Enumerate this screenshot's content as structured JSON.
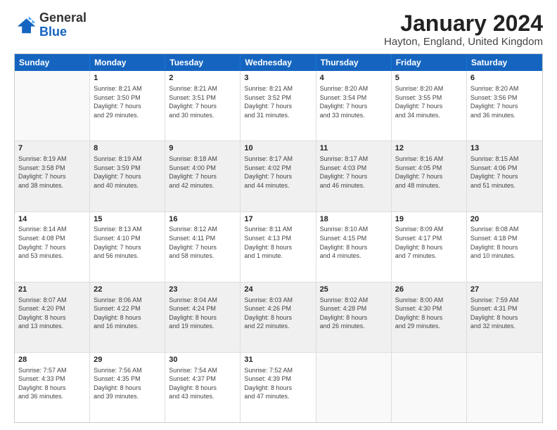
{
  "header": {
    "logo_general": "General",
    "logo_blue": "Blue",
    "month_title": "January 2024",
    "location": "Hayton, England, United Kingdom"
  },
  "days_of_week": [
    "Sunday",
    "Monday",
    "Tuesday",
    "Wednesday",
    "Thursday",
    "Friday",
    "Saturday"
  ],
  "weeks": [
    [
      {
        "day": "",
        "info": "",
        "empty": true
      },
      {
        "day": "1",
        "info": "Sunrise: 8:21 AM\nSunset: 3:50 PM\nDaylight: 7 hours\nand 29 minutes.",
        "shaded": false
      },
      {
        "day": "2",
        "info": "Sunrise: 8:21 AM\nSunset: 3:51 PM\nDaylight: 7 hours\nand 30 minutes.",
        "shaded": false
      },
      {
        "day": "3",
        "info": "Sunrise: 8:21 AM\nSunset: 3:52 PM\nDaylight: 7 hours\nand 31 minutes.",
        "shaded": false
      },
      {
        "day": "4",
        "info": "Sunrise: 8:20 AM\nSunset: 3:54 PM\nDaylight: 7 hours\nand 33 minutes.",
        "shaded": false
      },
      {
        "day": "5",
        "info": "Sunrise: 8:20 AM\nSunset: 3:55 PM\nDaylight: 7 hours\nand 34 minutes.",
        "shaded": false
      },
      {
        "day": "6",
        "info": "Sunrise: 8:20 AM\nSunset: 3:56 PM\nDaylight: 7 hours\nand 36 minutes.",
        "shaded": false
      }
    ],
    [
      {
        "day": "7",
        "info": "Sunrise: 8:19 AM\nSunset: 3:58 PM\nDaylight: 7 hours\nand 38 minutes.",
        "shaded": true
      },
      {
        "day": "8",
        "info": "Sunrise: 8:19 AM\nSunset: 3:59 PM\nDaylight: 7 hours\nand 40 minutes.",
        "shaded": true
      },
      {
        "day": "9",
        "info": "Sunrise: 8:18 AM\nSunset: 4:00 PM\nDaylight: 7 hours\nand 42 minutes.",
        "shaded": true
      },
      {
        "day": "10",
        "info": "Sunrise: 8:17 AM\nSunset: 4:02 PM\nDaylight: 7 hours\nand 44 minutes.",
        "shaded": true
      },
      {
        "day": "11",
        "info": "Sunrise: 8:17 AM\nSunset: 4:03 PM\nDaylight: 7 hours\nand 46 minutes.",
        "shaded": true
      },
      {
        "day": "12",
        "info": "Sunrise: 8:16 AM\nSunset: 4:05 PM\nDaylight: 7 hours\nand 48 minutes.",
        "shaded": true
      },
      {
        "day": "13",
        "info": "Sunrise: 8:15 AM\nSunset: 4:06 PM\nDaylight: 7 hours\nand 51 minutes.",
        "shaded": true
      }
    ],
    [
      {
        "day": "14",
        "info": "Sunrise: 8:14 AM\nSunset: 4:08 PM\nDaylight: 7 hours\nand 53 minutes.",
        "shaded": false
      },
      {
        "day": "15",
        "info": "Sunrise: 8:13 AM\nSunset: 4:10 PM\nDaylight: 7 hours\nand 56 minutes.",
        "shaded": false
      },
      {
        "day": "16",
        "info": "Sunrise: 8:12 AM\nSunset: 4:11 PM\nDaylight: 7 hours\nand 58 minutes.",
        "shaded": false
      },
      {
        "day": "17",
        "info": "Sunrise: 8:11 AM\nSunset: 4:13 PM\nDaylight: 8 hours\nand 1 minute.",
        "shaded": false
      },
      {
        "day": "18",
        "info": "Sunrise: 8:10 AM\nSunset: 4:15 PM\nDaylight: 8 hours\nand 4 minutes.",
        "shaded": false
      },
      {
        "day": "19",
        "info": "Sunrise: 8:09 AM\nSunset: 4:17 PM\nDaylight: 8 hours\nand 7 minutes.",
        "shaded": false
      },
      {
        "day": "20",
        "info": "Sunrise: 8:08 AM\nSunset: 4:18 PM\nDaylight: 8 hours\nand 10 minutes.",
        "shaded": false
      }
    ],
    [
      {
        "day": "21",
        "info": "Sunrise: 8:07 AM\nSunset: 4:20 PM\nDaylight: 8 hours\nand 13 minutes.",
        "shaded": true
      },
      {
        "day": "22",
        "info": "Sunrise: 8:06 AM\nSunset: 4:22 PM\nDaylight: 8 hours\nand 16 minutes.",
        "shaded": true
      },
      {
        "day": "23",
        "info": "Sunrise: 8:04 AM\nSunset: 4:24 PM\nDaylight: 8 hours\nand 19 minutes.",
        "shaded": true
      },
      {
        "day": "24",
        "info": "Sunrise: 8:03 AM\nSunset: 4:26 PM\nDaylight: 8 hours\nand 22 minutes.",
        "shaded": true
      },
      {
        "day": "25",
        "info": "Sunrise: 8:02 AM\nSunset: 4:28 PM\nDaylight: 8 hours\nand 26 minutes.",
        "shaded": true
      },
      {
        "day": "26",
        "info": "Sunrise: 8:00 AM\nSunset: 4:30 PM\nDaylight: 8 hours\nand 29 minutes.",
        "shaded": true
      },
      {
        "day": "27",
        "info": "Sunrise: 7:59 AM\nSunset: 4:31 PM\nDaylight: 8 hours\nand 32 minutes.",
        "shaded": true
      }
    ],
    [
      {
        "day": "28",
        "info": "Sunrise: 7:57 AM\nSunset: 4:33 PM\nDaylight: 8 hours\nand 36 minutes.",
        "shaded": false
      },
      {
        "day": "29",
        "info": "Sunrise: 7:56 AM\nSunset: 4:35 PM\nDaylight: 8 hours\nand 39 minutes.",
        "shaded": false
      },
      {
        "day": "30",
        "info": "Sunrise: 7:54 AM\nSunset: 4:37 PM\nDaylight: 8 hours\nand 43 minutes.",
        "shaded": false
      },
      {
        "day": "31",
        "info": "Sunrise: 7:52 AM\nSunset: 4:39 PM\nDaylight: 8 hours\nand 47 minutes.",
        "shaded": false
      },
      {
        "day": "",
        "info": "",
        "empty": true
      },
      {
        "day": "",
        "info": "",
        "empty": true
      },
      {
        "day": "",
        "info": "",
        "empty": true
      }
    ]
  ]
}
